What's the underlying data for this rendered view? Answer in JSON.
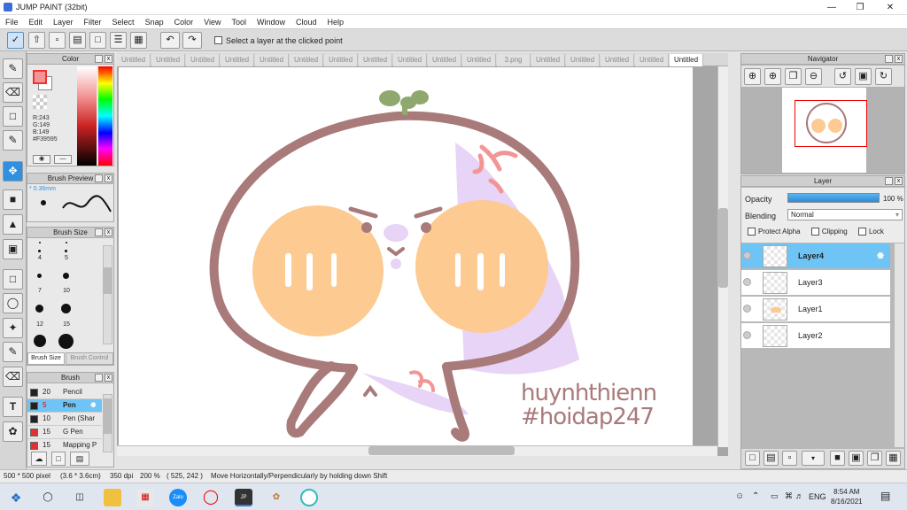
{
  "window": {
    "title": "JUMP PAINT (32bit)"
  },
  "menu": [
    "File",
    "Edit",
    "Layer",
    "Filter",
    "Select",
    "Snap",
    "Color",
    "View",
    "Tool",
    "Window",
    "Cloud",
    "Help"
  ],
  "toolbar": {
    "select_layer_label": "Select a layer at the clicked point"
  },
  "tabs": [
    "Untitled",
    "Untitled",
    "Untitled",
    "Untitled",
    "Untitled",
    "Untitled",
    "Untitled",
    "Untitled",
    "Untitled",
    "Untitled",
    "Untitled",
    "3.png",
    "Untitled",
    "Untitled",
    "Untitled",
    "Untitled",
    "Untitled"
  ],
  "color_panel": {
    "title": "Color",
    "r": "R:243",
    "g": "G:149",
    "b": "B:149",
    "hex": "#F39595",
    "current_color": "#F39595"
  },
  "brush_preview": {
    "title": "Brush Preview",
    "size": "* 0.36mm"
  },
  "brush_size": {
    "title": "Brush Size",
    "sizes": [
      "4",
      "5",
      "7",
      "10",
      "12",
      "15"
    ],
    "tab1": "Brush Size",
    "tab2": "Brush Control"
  },
  "brush_panel": {
    "title": "Brush",
    "items": [
      {
        "size": "20",
        "name": "Pencil",
        "color": "#222222"
      },
      {
        "size": "5",
        "name": "Pen",
        "color": "#222222"
      },
      {
        "size": "10",
        "name": "Pen (Shar",
        "color": "#222222"
      },
      {
        "size": "15",
        "name": "G Pen",
        "color": "#e03030"
      },
      {
        "size": "15",
        "name": "Mapping P",
        "color": "#e03030"
      }
    ]
  },
  "navigator": {
    "title": "Navigator"
  },
  "layer_panel": {
    "title": "Layer",
    "opacity_label": "Opacity",
    "opacity_value": "100 %",
    "opacity": 1.0,
    "blending_label": "Blending",
    "blending_value": "Normal",
    "protect_alpha": "Protect Alpha",
    "clipping": "Clipping",
    "lock": "Lock",
    "layers": [
      "Layer4",
      "Layer3",
      "Layer1",
      "Layer2"
    ]
  },
  "artwork": {
    "line1": "huynhthienn",
    "line2": "#hoidap247"
  },
  "status": {
    "dims": "500 * 500 pixel",
    "size_cm": "(3.6 * 3.6cm)",
    "dpi": "350 dpi",
    "zoom": "200 %",
    "coords": "( 525, 242 )",
    "hint": "Move Horizontally/Perpendicularly by holding down Shift"
  },
  "taskbar": {
    "time": "8:54 AM",
    "date": "8/16/2021",
    "lang": "ENG"
  }
}
